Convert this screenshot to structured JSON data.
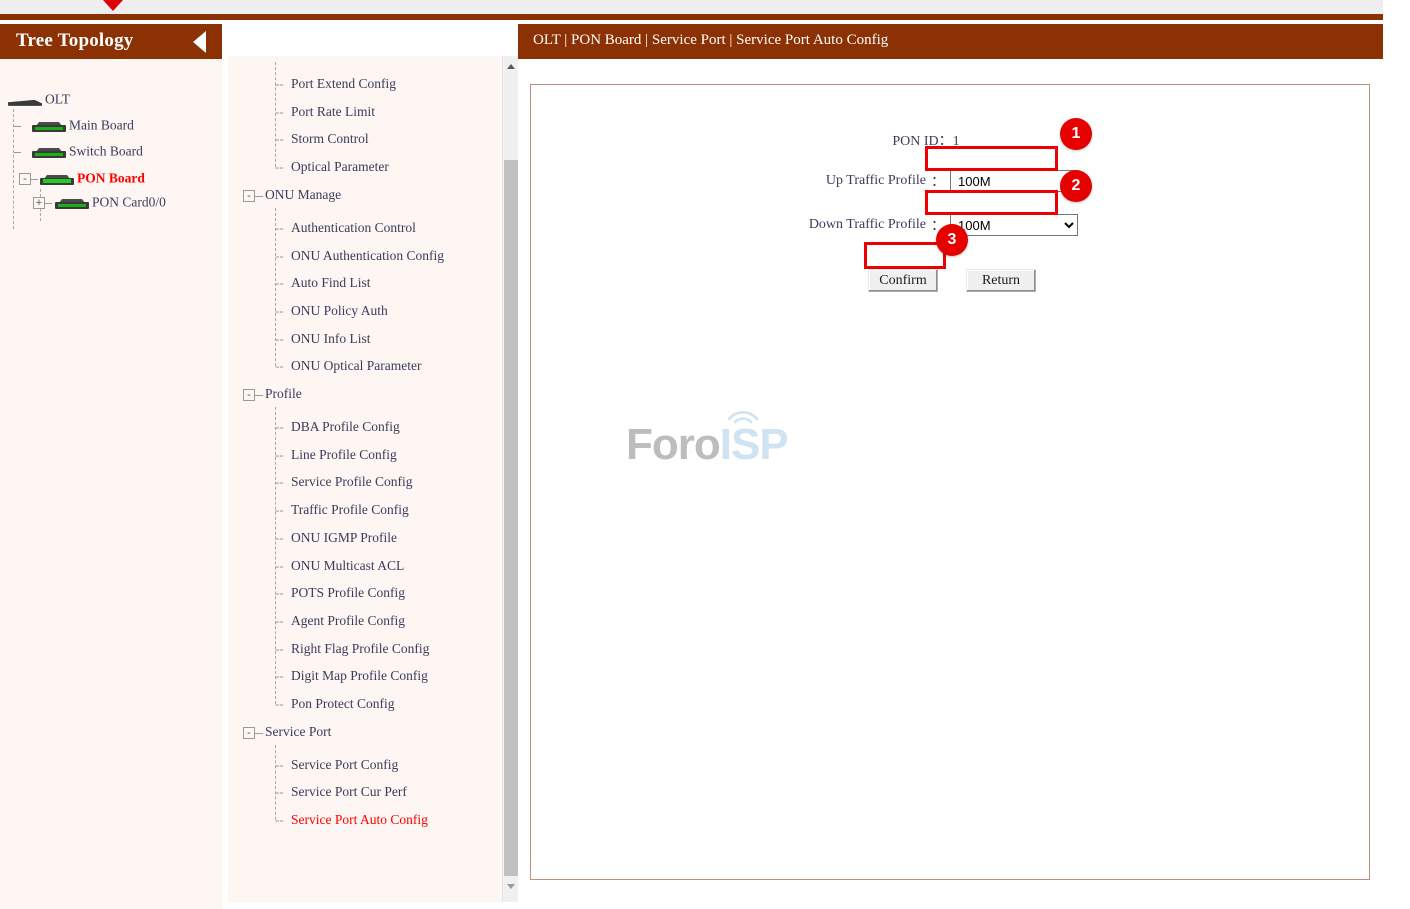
{
  "window": {
    "top_marker_icon": "red-triangle-down"
  },
  "tree_panel": {
    "title": "Tree Topology",
    "collapse_icon": "triangle-left-icon",
    "nodes": [
      {
        "label": "OLT",
        "icon": "device-flat-icon",
        "level": 0,
        "expander": "",
        "active": false
      },
      {
        "label": "Main Board",
        "icon": "device-board-icon",
        "level": 1,
        "expander": "",
        "active": false
      },
      {
        "label": "Switch Board",
        "icon": "device-board-icon",
        "level": 1,
        "expander": "",
        "active": false
      },
      {
        "label": "PON Board",
        "icon": "device-board-icon",
        "level": 1,
        "expander": "-",
        "active": true
      },
      {
        "label": "PON Card0/0",
        "icon": "device-board-icon",
        "level": 2,
        "expander": "+",
        "active": false
      }
    ]
  },
  "menu": {
    "items": [
      {
        "label": "Port Extend Config",
        "type": "leaf",
        "active": false
      },
      {
        "label": "Port Rate Limit",
        "type": "leaf",
        "active": false
      },
      {
        "label": "Storm Control",
        "type": "leaf",
        "active": false
      },
      {
        "label": "Optical Parameter",
        "type": "leaf",
        "active": false
      },
      {
        "label": "ONU Manage",
        "type": "group",
        "active": false
      },
      {
        "label": "Authentication Control",
        "type": "leaf",
        "active": false
      },
      {
        "label": "ONU Authentication Config",
        "type": "leaf",
        "active": false
      },
      {
        "label": "Auto Find List",
        "type": "leaf",
        "active": false
      },
      {
        "label": "ONU Policy Auth",
        "type": "leaf",
        "active": false
      },
      {
        "label": "ONU Info List",
        "type": "leaf",
        "active": false
      },
      {
        "label": "ONU Optical Parameter",
        "type": "leaf",
        "active": false
      },
      {
        "label": "Profile",
        "type": "group",
        "active": false
      },
      {
        "label": "DBA Profile Config",
        "type": "leaf",
        "active": false
      },
      {
        "label": "Line Profile Config",
        "type": "leaf",
        "active": false
      },
      {
        "label": "Service Profile Config",
        "type": "leaf",
        "active": false
      },
      {
        "label": "Traffic Profile Config",
        "type": "leaf",
        "active": false
      },
      {
        "label": "ONU IGMP Profile",
        "type": "leaf",
        "active": false
      },
      {
        "label": "ONU Multicast ACL",
        "type": "leaf",
        "active": false
      },
      {
        "label": "POTS Profile Config",
        "type": "leaf",
        "active": false
      },
      {
        "label": "Agent Profile Config",
        "type": "leaf",
        "active": false
      },
      {
        "label": "Right Flag Profile Config",
        "type": "leaf",
        "active": false
      },
      {
        "label": "Digit Map Profile Config",
        "type": "leaf",
        "active": false
      },
      {
        "label": "Pon Protect Config",
        "type": "leaf",
        "active": false
      },
      {
        "label": "Service Port",
        "type": "group",
        "active": false
      },
      {
        "label": "Service Port Config",
        "type": "leaf",
        "active": false
      },
      {
        "label": "Service Port Cur Perf",
        "type": "leaf",
        "active": false
      },
      {
        "label": "Service Port Auto Config",
        "type": "leaf",
        "active": true
      }
    ],
    "scrollbar": {
      "up_icon": "triangle-up-icon",
      "down_icon": "triangle-down-icon"
    }
  },
  "content": {
    "breadcrumb": "OLT | PON Board | Service Port | Service Port Auto Config",
    "form": {
      "pon_id_label": "PON ID",
      "pon_id_value": "1",
      "colon": "：",
      "up_traffic_label": "Up Traffic Profile",
      "up_traffic_value": "100M",
      "up_traffic_options": [
        "100M"
      ],
      "down_traffic_label": "Down Traffic Profile",
      "down_traffic_value": "100M",
      "down_traffic_options": [
        "100M"
      ],
      "confirm_label": "Confirm",
      "return_label": "Return"
    },
    "watermark": {
      "part1": "Foro",
      "part2": "ISP"
    }
  },
  "annotations": {
    "badges": [
      {
        "number": "1",
        "target": "up-traffic-profile-select"
      },
      {
        "number": "2",
        "target": "down-traffic-profile-select"
      },
      {
        "number": "3",
        "target": "confirm-button"
      }
    ],
    "color": "#ee0000"
  }
}
